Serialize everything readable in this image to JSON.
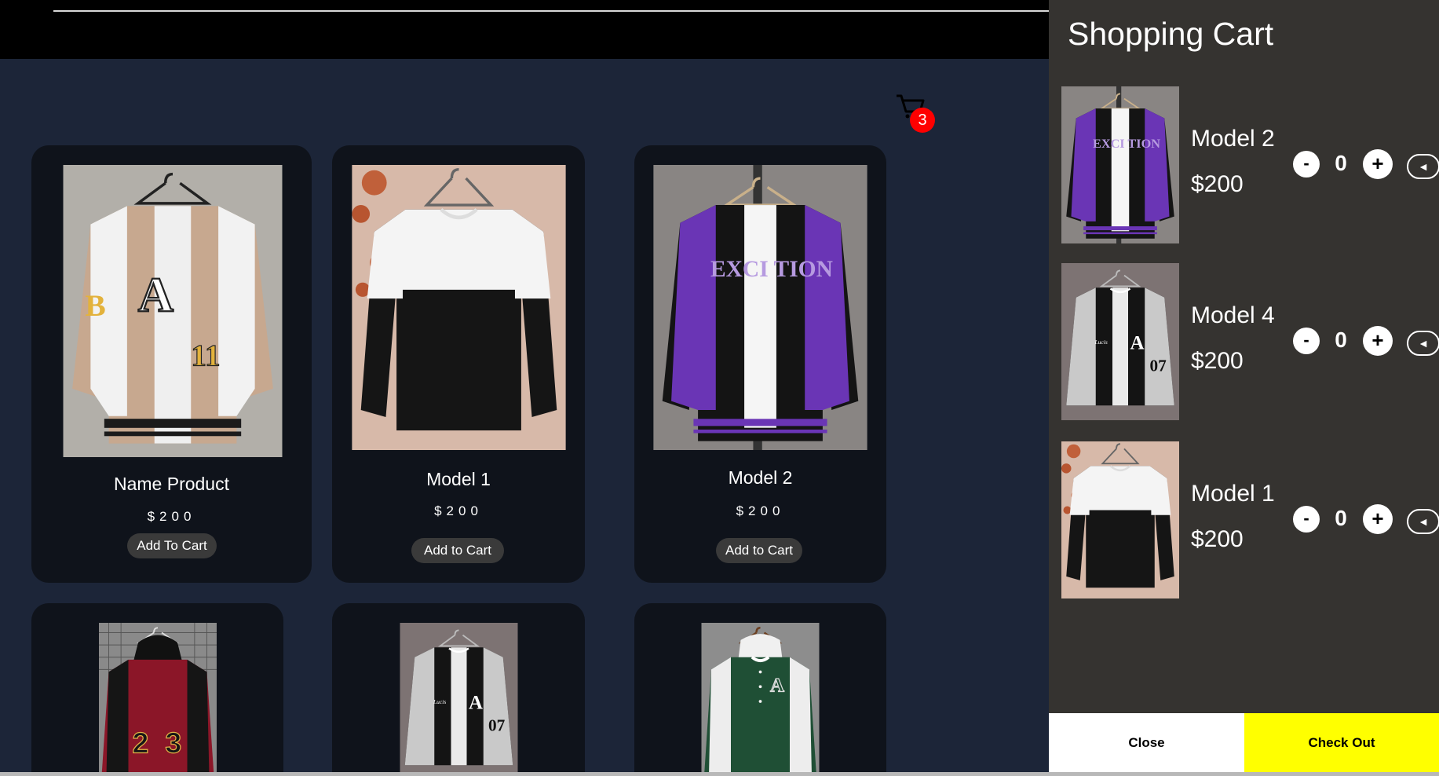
{
  "cart_icon": {
    "icon": "cart-icon",
    "count": "3",
    "badge_color": "#ff0000"
  },
  "products": [
    {
      "name": "Name Product",
      "price": "$200",
      "button": "Add To Cart",
      "image": "beige-varsity-jacket"
    },
    {
      "name": "Model 1",
      "price": "$200",
      "button": "Add to Cart",
      "image": "black-white-sweater"
    },
    {
      "name": "Model 2",
      "price": "$200",
      "button": "Add to Cart",
      "image": "purple-varsity-jacket"
    },
    {
      "image": "red-hooded-varsity-jacket"
    },
    {
      "image": "black-grey-varsity-jacket"
    },
    {
      "image": "green-hooded-varsity-jacket"
    }
  ],
  "cart": {
    "title": "Shopping Cart",
    "items": [
      {
        "name": "Model 2",
        "price": "$200",
        "quantity": "0",
        "minus": "-",
        "plus": "+",
        "remove": "◄",
        "image": "purple-varsity-jacket"
      },
      {
        "name": "Model 4",
        "price": "$200",
        "quantity": "0",
        "minus": "-",
        "plus": "+",
        "remove": "◄",
        "image": "black-grey-varsity-jacket"
      },
      {
        "name": "Model 1",
        "price": "$200",
        "quantity": "0",
        "minus": "-",
        "plus": "+",
        "remove": "◄",
        "image": "black-white-sweater"
      }
    ],
    "close_label": "Close",
    "checkout_label": "Check Out",
    "checkout_color": "#ffff00"
  },
  "colors": {
    "page_bg": "#1c2538",
    "card_bg": "#0f131b",
    "panel_bg": "#353330",
    "topbar_bg": "#000000"
  }
}
